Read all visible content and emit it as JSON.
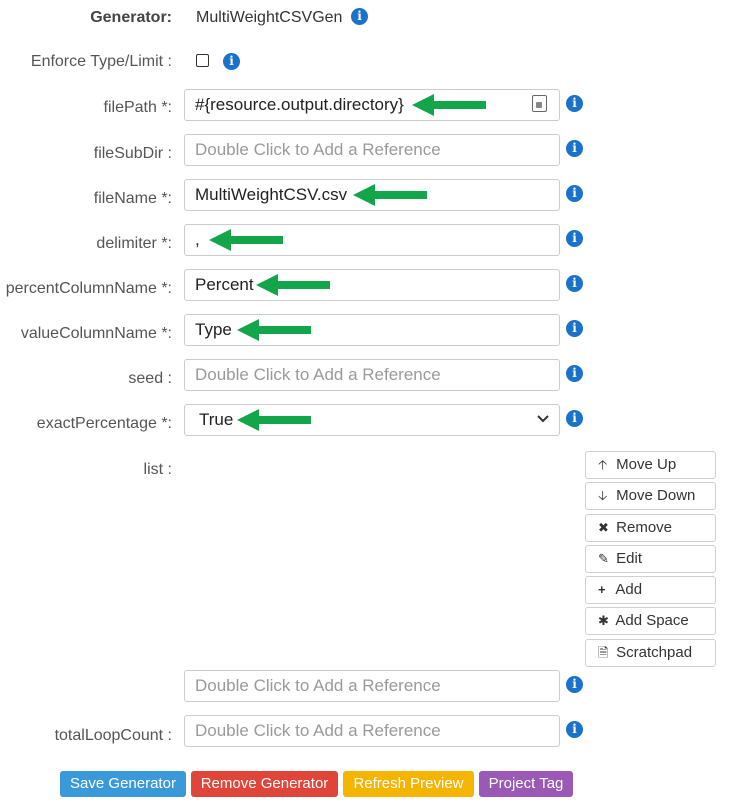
{
  "generator": {
    "label": "Generator:",
    "value": "MultiWeightCSVGen"
  },
  "enforce": {
    "label": "Enforce Type/Limit :"
  },
  "fields": {
    "filePath": {
      "label": "filePath *:",
      "value": "#{resource.output.directory}"
    },
    "fileSubDir": {
      "label": "fileSubDir :",
      "placeholder": "Double Click to Add a Reference"
    },
    "fileName": {
      "label": "fileName *:",
      "value": "MultiWeightCSV.csv"
    },
    "delimiter": {
      "label": "delimiter *:",
      "value": ","
    },
    "percentColumnName": {
      "label": "percentColumnName *:",
      "value": "Percent"
    },
    "valueColumnName": {
      "label": "valueColumnName *:",
      "value": "Type"
    },
    "seed": {
      "label": "seed :",
      "placeholder": "Double Click to Add a Reference"
    },
    "exactPercentage": {
      "label": "exactPercentage *:",
      "value": "True"
    },
    "list": {
      "label": "list :",
      "placeholder": "Double Click to Add a Reference"
    },
    "totalLoopCount": {
      "label": "totalLoopCount :",
      "placeholder": "Double Click to Add a Reference"
    }
  },
  "list_buttons": [
    {
      "label": "Move Up",
      "icon": "arrow-up-icon"
    },
    {
      "label": "Move Down",
      "icon": "arrow-down-icon"
    },
    {
      "label": "Remove",
      "icon": "x-icon"
    },
    {
      "label": "Edit",
      "icon": "pencil-icon"
    },
    {
      "label": "Add",
      "icon": "plus-icon"
    },
    {
      "label": "Add Space",
      "icon": "asterisk-icon"
    },
    {
      "label": "Scratchpad",
      "icon": "file-icon"
    }
  ],
  "footer": {
    "save": "Save Generator",
    "remove": "Remove Generator",
    "refresh": "Refresh Preview",
    "tag": "Project Tag"
  },
  "colors": {
    "info": "#1a73c8",
    "arrow": "#12a54a",
    "save": "#3a9ad9",
    "remove": "#e0453a",
    "refresh": "#f5b400",
    "tag": "#9b59b6"
  }
}
